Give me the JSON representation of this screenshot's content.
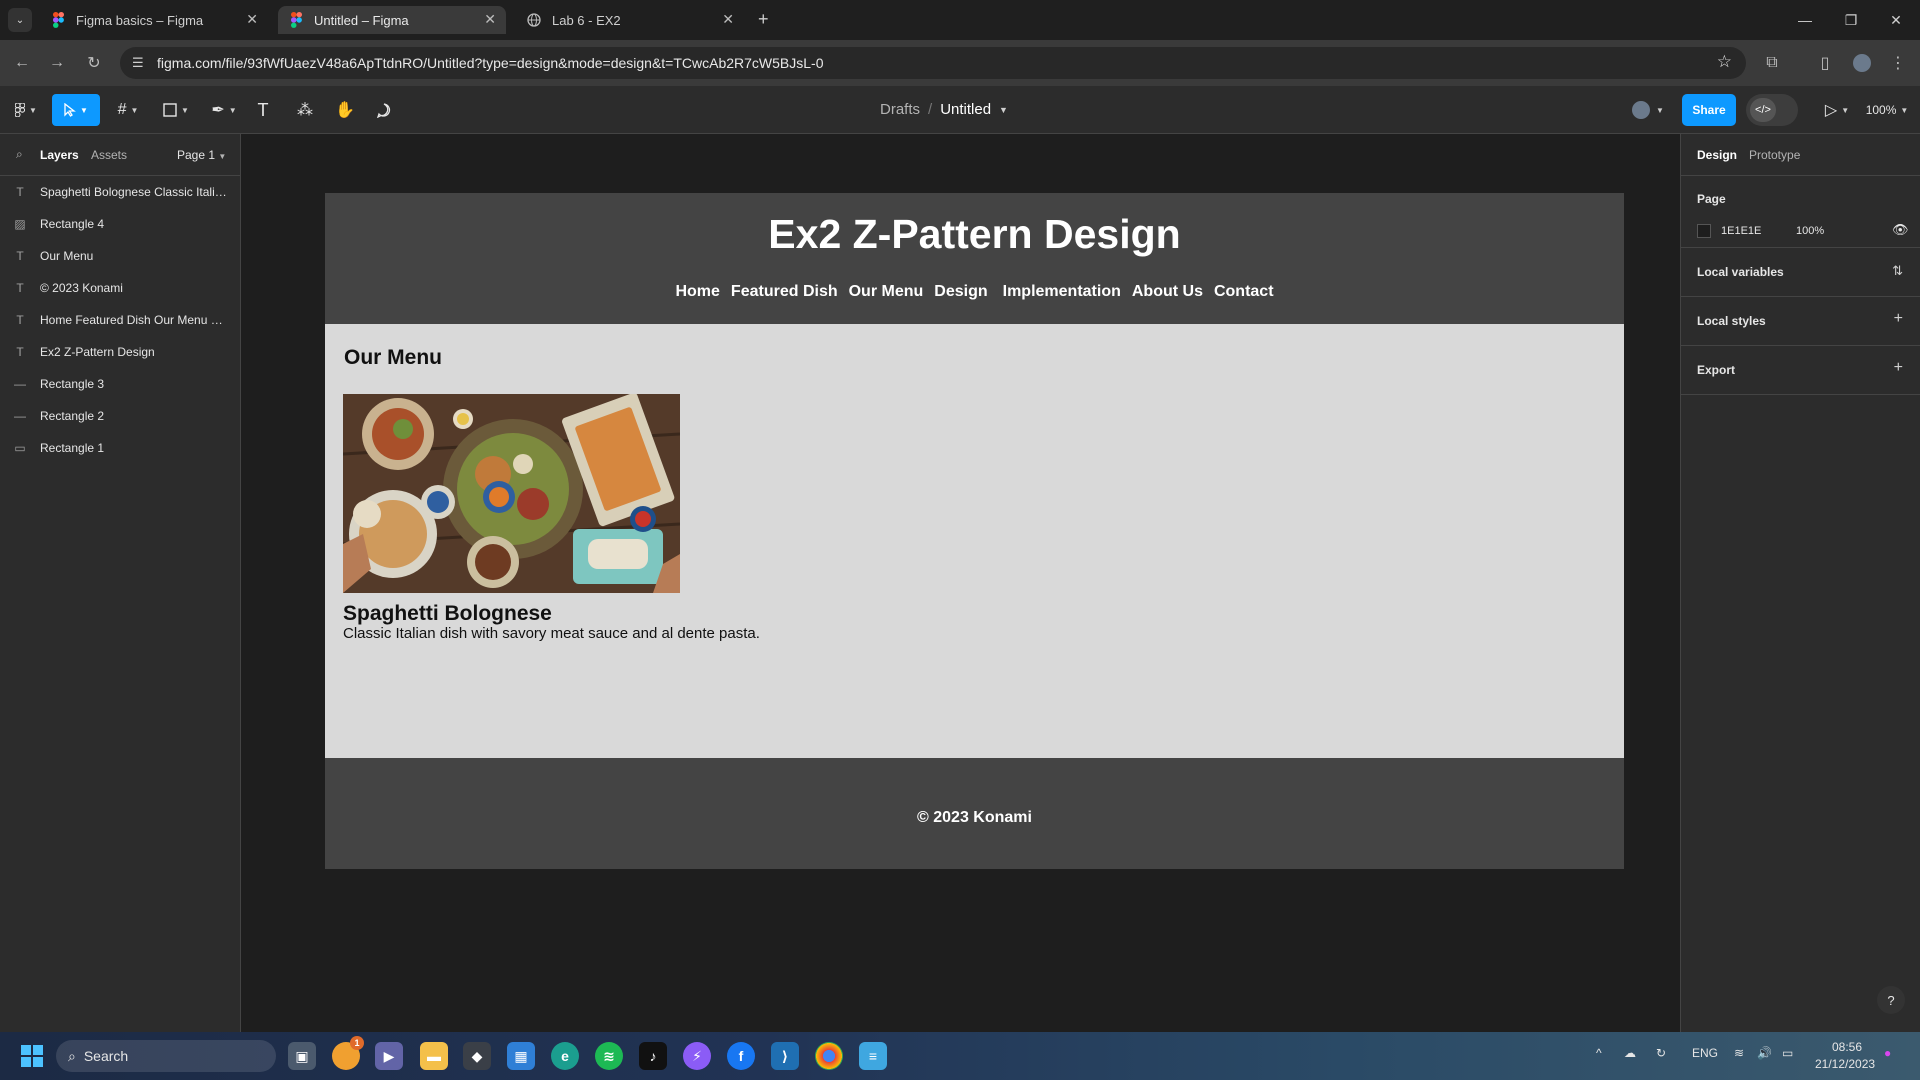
{
  "browser": {
    "tabs": [
      {
        "title": "Figma basics – Figma",
        "active": false
      },
      {
        "title": "Untitled – Figma",
        "active": true
      },
      {
        "title": "Lab 6 - EX2",
        "active": false
      }
    ],
    "url": "figma.com/file/93fWfUaezV48a6ApTtdnRO/Untitled?type=design&mode=design&t=TCwcAb2R7cW5BJsL-0"
  },
  "toolbar": {
    "breadcrumb_parent": "Drafts",
    "breadcrumb_sep": "/",
    "file_name": "Untitled",
    "share_label": "Share",
    "zoom": "100%"
  },
  "left_panel": {
    "tabs": [
      "Layers",
      "Assets"
    ],
    "page_selector": "Page 1",
    "layers": [
      {
        "type": "text",
        "name": "Spaghetti Bolognese Classic Italia..."
      },
      {
        "type": "image",
        "name": "Rectangle 4"
      },
      {
        "type": "text",
        "name": "Our Menu"
      },
      {
        "type": "text",
        "name": "© 2023 Konami"
      },
      {
        "type": "text",
        "name": "Home Featured Dish Our Menu De..."
      },
      {
        "type": "text",
        "name": "Ex2 Z-Pattern Design"
      },
      {
        "type": "line",
        "name": "Rectangle 3"
      },
      {
        "type": "line",
        "name": "Rectangle 2"
      },
      {
        "type": "rect",
        "name": "Rectangle 1"
      }
    ]
  },
  "frame": {
    "title": "Ex2 Z-Pattern Design",
    "nav": [
      "Home",
      "Featured Dish",
      "Our Menu",
      "Design",
      "Implementation",
      "About Us",
      "Contact"
    ],
    "menu_heading": "Our Menu",
    "dish_name": "Spaghetti Bolognese",
    "dish_desc": "Classic Italian dish with savory meat sauce and al dente pasta.",
    "footer": "© 2023 Konami"
  },
  "right_panel": {
    "tabs": [
      "Design",
      "Prototype"
    ],
    "page_label": "Page",
    "page_color": "1E1E1E",
    "page_opacity": "100%",
    "sections": [
      "Local variables",
      "Local styles",
      "Export"
    ],
    "help": "?"
  },
  "taskbar": {
    "search": "Search",
    "lang": "ENG",
    "time": "08:56",
    "date": "21/12/2023",
    "badge": "1"
  },
  "colors": {
    "accent": "#0d99ff",
    "frame_bg": "#d9d9d9",
    "frame_header": "#444444"
  }
}
